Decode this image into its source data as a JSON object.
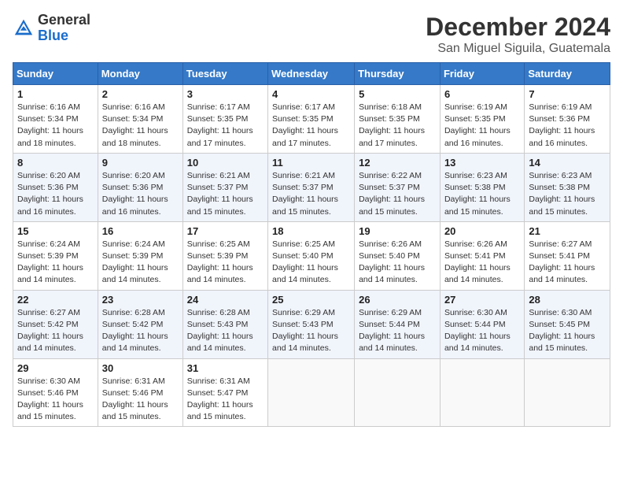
{
  "header": {
    "logo_general": "General",
    "logo_blue": "Blue",
    "month_title": "December 2024",
    "location": "San Miguel Siguila, Guatemala"
  },
  "weekdays": [
    "Sunday",
    "Monday",
    "Tuesday",
    "Wednesday",
    "Thursday",
    "Friday",
    "Saturday"
  ],
  "weeks": [
    [
      {
        "day": "1",
        "sunrise": "Sunrise: 6:16 AM",
        "sunset": "Sunset: 5:34 PM",
        "daylight": "Daylight: 11 hours and 18 minutes."
      },
      {
        "day": "2",
        "sunrise": "Sunrise: 6:16 AM",
        "sunset": "Sunset: 5:34 PM",
        "daylight": "Daylight: 11 hours and 18 minutes."
      },
      {
        "day": "3",
        "sunrise": "Sunrise: 6:17 AM",
        "sunset": "Sunset: 5:35 PM",
        "daylight": "Daylight: 11 hours and 17 minutes."
      },
      {
        "day": "4",
        "sunrise": "Sunrise: 6:17 AM",
        "sunset": "Sunset: 5:35 PM",
        "daylight": "Daylight: 11 hours and 17 minutes."
      },
      {
        "day": "5",
        "sunrise": "Sunrise: 6:18 AM",
        "sunset": "Sunset: 5:35 PM",
        "daylight": "Daylight: 11 hours and 17 minutes."
      },
      {
        "day": "6",
        "sunrise": "Sunrise: 6:19 AM",
        "sunset": "Sunset: 5:35 PM",
        "daylight": "Daylight: 11 hours and 16 minutes."
      },
      {
        "day": "7",
        "sunrise": "Sunrise: 6:19 AM",
        "sunset": "Sunset: 5:36 PM",
        "daylight": "Daylight: 11 hours and 16 minutes."
      }
    ],
    [
      {
        "day": "8",
        "sunrise": "Sunrise: 6:20 AM",
        "sunset": "Sunset: 5:36 PM",
        "daylight": "Daylight: 11 hours and 16 minutes."
      },
      {
        "day": "9",
        "sunrise": "Sunrise: 6:20 AM",
        "sunset": "Sunset: 5:36 PM",
        "daylight": "Daylight: 11 hours and 16 minutes."
      },
      {
        "day": "10",
        "sunrise": "Sunrise: 6:21 AM",
        "sunset": "Sunset: 5:37 PM",
        "daylight": "Daylight: 11 hours and 15 minutes."
      },
      {
        "day": "11",
        "sunrise": "Sunrise: 6:21 AM",
        "sunset": "Sunset: 5:37 PM",
        "daylight": "Daylight: 11 hours and 15 minutes."
      },
      {
        "day": "12",
        "sunrise": "Sunrise: 6:22 AM",
        "sunset": "Sunset: 5:37 PM",
        "daylight": "Daylight: 11 hours and 15 minutes."
      },
      {
        "day": "13",
        "sunrise": "Sunrise: 6:23 AM",
        "sunset": "Sunset: 5:38 PM",
        "daylight": "Daylight: 11 hours and 15 minutes."
      },
      {
        "day": "14",
        "sunrise": "Sunrise: 6:23 AM",
        "sunset": "Sunset: 5:38 PM",
        "daylight": "Daylight: 11 hours and 15 minutes."
      }
    ],
    [
      {
        "day": "15",
        "sunrise": "Sunrise: 6:24 AM",
        "sunset": "Sunset: 5:39 PM",
        "daylight": "Daylight: 11 hours and 14 minutes."
      },
      {
        "day": "16",
        "sunrise": "Sunrise: 6:24 AM",
        "sunset": "Sunset: 5:39 PM",
        "daylight": "Daylight: 11 hours and 14 minutes."
      },
      {
        "day": "17",
        "sunrise": "Sunrise: 6:25 AM",
        "sunset": "Sunset: 5:39 PM",
        "daylight": "Daylight: 11 hours and 14 minutes."
      },
      {
        "day": "18",
        "sunrise": "Sunrise: 6:25 AM",
        "sunset": "Sunset: 5:40 PM",
        "daylight": "Daylight: 11 hours and 14 minutes."
      },
      {
        "day": "19",
        "sunrise": "Sunrise: 6:26 AM",
        "sunset": "Sunset: 5:40 PM",
        "daylight": "Daylight: 11 hours and 14 minutes."
      },
      {
        "day": "20",
        "sunrise": "Sunrise: 6:26 AM",
        "sunset": "Sunset: 5:41 PM",
        "daylight": "Daylight: 11 hours and 14 minutes."
      },
      {
        "day": "21",
        "sunrise": "Sunrise: 6:27 AM",
        "sunset": "Sunset: 5:41 PM",
        "daylight": "Daylight: 11 hours and 14 minutes."
      }
    ],
    [
      {
        "day": "22",
        "sunrise": "Sunrise: 6:27 AM",
        "sunset": "Sunset: 5:42 PM",
        "daylight": "Daylight: 11 hours and 14 minutes."
      },
      {
        "day": "23",
        "sunrise": "Sunrise: 6:28 AM",
        "sunset": "Sunset: 5:42 PM",
        "daylight": "Daylight: 11 hours and 14 minutes."
      },
      {
        "day": "24",
        "sunrise": "Sunrise: 6:28 AM",
        "sunset": "Sunset: 5:43 PM",
        "daylight": "Daylight: 11 hours and 14 minutes."
      },
      {
        "day": "25",
        "sunrise": "Sunrise: 6:29 AM",
        "sunset": "Sunset: 5:43 PM",
        "daylight": "Daylight: 11 hours and 14 minutes."
      },
      {
        "day": "26",
        "sunrise": "Sunrise: 6:29 AM",
        "sunset": "Sunset: 5:44 PM",
        "daylight": "Daylight: 11 hours and 14 minutes."
      },
      {
        "day": "27",
        "sunrise": "Sunrise: 6:30 AM",
        "sunset": "Sunset: 5:44 PM",
        "daylight": "Daylight: 11 hours and 14 minutes."
      },
      {
        "day": "28",
        "sunrise": "Sunrise: 6:30 AM",
        "sunset": "Sunset: 5:45 PM",
        "daylight": "Daylight: 11 hours and 15 minutes."
      }
    ],
    [
      {
        "day": "29",
        "sunrise": "Sunrise: 6:30 AM",
        "sunset": "Sunset: 5:46 PM",
        "daylight": "Daylight: 11 hours and 15 minutes."
      },
      {
        "day": "30",
        "sunrise": "Sunrise: 6:31 AM",
        "sunset": "Sunset: 5:46 PM",
        "daylight": "Daylight: 11 hours and 15 minutes."
      },
      {
        "day": "31",
        "sunrise": "Sunrise: 6:31 AM",
        "sunset": "Sunset: 5:47 PM",
        "daylight": "Daylight: 11 hours and 15 minutes."
      },
      null,
      null,
      null,
      null
    ]
  ]
}
